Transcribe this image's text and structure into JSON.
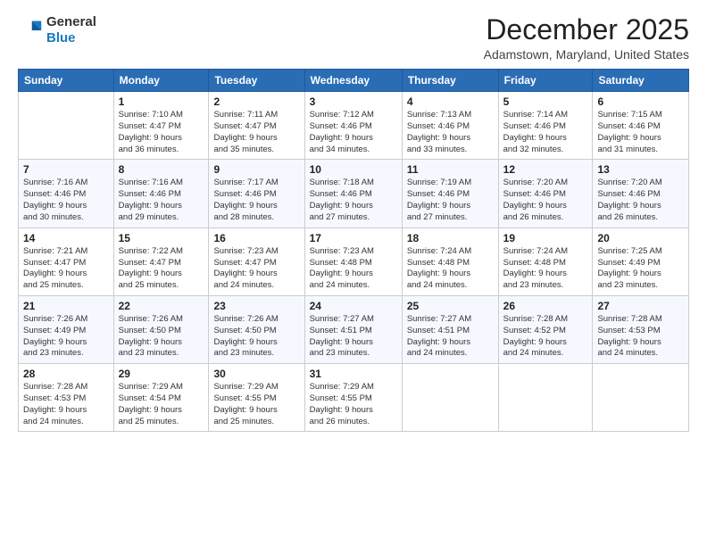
{
  "header": {
    "logo_line1": "General",
    "logo_line2": "Blue",
    "title": "December 2025",
    "subtitle": "Adamstown, Maryland, United States"
  },
  "days_of_week": [
    "Sunday",
    "Monday",
    "Tuesday",
    "Wednesday",
    "Thursday",
    "Friday",
    "Saturday"
  ],
  "weeks": [
    [
      {
        "day": "",
        "info": ""
      },
      {
        "day": "1",
        "info": "Sunrise: 7:10 AM\nSunset: 4:47 PM\nDaylight: 9 hours\nand 36 minutes."
      },
      {
        "day": "2",
        "info": "Sunrise: 7:11 AM\nSunset: 4:47 PM\nDaylight: 9 hours\nand 35 minutes."
      },
      {
        "day": "3",
        "info": "Sunrise: 7:12 AM\nSunset: 4:46 PM\nDaylight: 9 hours\nand 34 minutes."
      },
      {
        "day": "4",
        "info": "Sunrise: 7:13 AM\nSunset: 4:46 PM\nDaylight: 9 hours\nand 33 minutes."
      },
      {
        "day": "5",
        "info": "Sunrise: 7:14 AM\nSunset: 4:46 PM\nDaylight: 9 hours\nand 32 minutes."
      },
      {
        "day": "6",
        "info": "Sunrise: 7:15 AM\nSunset: 4:46 PM\nDaylight: 9 hours\nand 31 minutes."
      }
    ],
    [
      {
        "day": "7",
        "info": "Sunrise: 7:16 AM\nSunset: 4:46 PM\nDaylight: 9 hours\nand 30 minutes."
      },
      {
        "day": "8",
        "info": "Sunrise: 7:16 AM\nSunset: 4:46 PM\nDaylight: 9 hours\nand 29 minutes."
      },
      {
        "day": "9",
        "info": "Sunrise: 7:17 AM\nSunset: 4:46 PM\nDaylight: 9 hours\nand 28 minutes."
      },
      {
        "day": "10",
        "info": "Sunrise: 7:18 AM\nSunset: 4:46 PM\nDaylight: 9 hours\nand 27 minutes."
      },
      {
        "day": "11",
        "info": "Sunrise: 7:19 AM\nSunset: 4:46 PM\nDaylight: 9 hours\nand 27 minutes."
      },
      {
        "day": "12",
        "info": "Sunrise: 7:20 AM\nSunset: 4:46 PM\nDaylight: 9 hours\nand 26 minutes."
      },
      {
        "day": "13",
        "info": "Sunrise: 7:20 AM\nSunset: 4:46 PM\nDaylight: 9 hours\nand 26 minutes."
      }
    ],
    [
      {
        "day": "14",
        "info": "Sunrise: 7:21 AM\nSunset: 4:47 PM\nDaylight: 9 hours\nand 25 minutes."
      },
      {
        "day": "15",
        "info": "Sunrise: 7:22 AM\nSunset: 4:47 PM\nDaylight: 9 hours\nand 25 minutes."
      },
      {
        "day": "16",
        "info": "Sunrise: 7:23 AM\nSunset: 4:47 PM\nDaylight: 9 hours\nand 24 minutes."
      },
      {
        "day": "17",
        "info": "Sunrise: 7:23 AM\nSunset: 4:48 PM\nDaylight: 9 hours\nand 24 minutes."
      },
      {
        "day": "18",
        "info": "Sunrise: 7:24 AM\nSunset: 4:48 PM\nDaylight: 9 hours\nand 24 minutes."
      },
      {
        "day": "19",
        "info": "Sunrise: 7:24 AM\nSunset: 4:48 PM\nDaylight: 9 hours\nand 23 minutes."
      },
      {
        "day": "20",
        "info": "Sunrise: 7:25 AM\nSunset: 4:49 PM\nDaylight: 9 hours\nand 23 minutes."
      }
    ],
    [
      {
        "day": "21",
        "info": "Sunrise: 7:26 AM\nSunset: 4:49 PM\nDaylight: 9 hours\nand 23 minutes."
      },
      {
        "day": "22",
        "info": "Sunrise: 7:26 AM\nSunset: 4:50 PM\nDaylight: 9 hours\nand 23 minutes."
      },
      {
        "day": "23",
        "info": "Sunrise: 7:26 AM\nSunset: 4:50 PM\nDaylight: 9 hours\nand 23 minutes."
      },
      {
        "day": "24",
        "info": "Sunrise: 7:27 AM\nSunset: 4:51 PM\nDaylight: 9 hours\nand 23 minutes."
      },
      {
        "day": "25",
        "info": "Sunrise: 7:27 AM\nSunset: 4:51 PM\nDaylight: 9 hours\nand 24 minutes."
      },
      {
        "day": "26",
        "info": "Sunrise: 7:28 AM\nSunset: 4:52 PM\nDaylight: 9 hours\nand 24 minutes."
      },
      {
        "day": "27",
        "info": "Sunrise: 7:28 AM\nSunset: 4:53 PM\nDaylight: 9 hours\nand 24 minutes."
      }
    ],
    [
      {
        "day": "28",
        "info": "Sunrise: 7:28 AM\nSunset: 4:53 PM\nDaylight: 9 hours\nand 24 minutes."
      },
      {
        "day": "29",
        "info": "Sunrise: 7:29 AM\nSunset: 4:54 PM\nDaylight: 9 hours\nand 25 minutes."
      },
      {
        "day": "30",
        "info": "Sunrise: 7:29 AM\nSunset: 4:55 PM\nDaylight: 9 hours\nand 25 minutes."
      },
      {
        "day": "31",
        "info": "Sunrise: 7:29 AM\nSunset: 4:55 PM\nDaylight: 9 hours\nand 26 minutes."
      },
      {
        "day": "",
        "info": ""
      },
      {
        "day": "",
        "info": ""
      },
      {
        "day": "",
        "info": ""
      }
    ]
  ]
}
